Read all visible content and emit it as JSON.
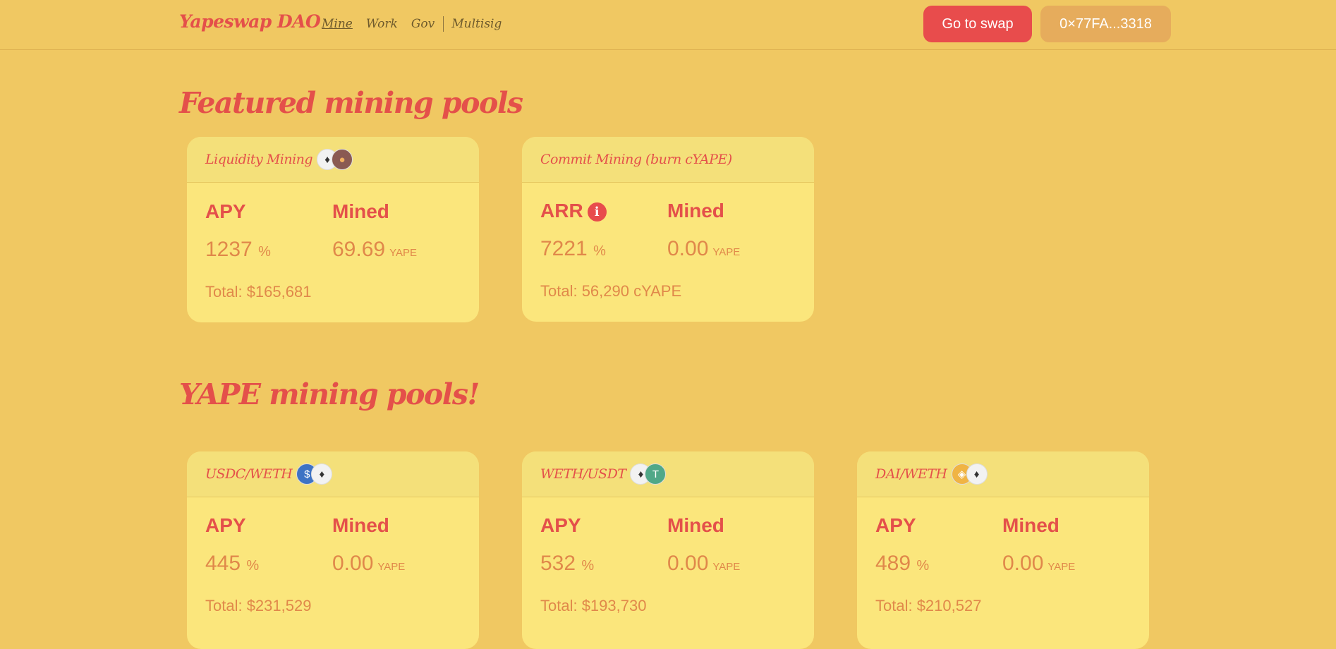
{
  "header": {
    "brand": "Yapeswap DAO",
    "nav": [
      "Mine",
      "Work",
      "Gov",
      "Multisig"
    ],
    "swap_button": "Go to swap",
    "wallet_button": "0×77FA...3318"
  },
  "featured": {
    "title": "Featured mining pools",
    "pools": [
      {
        "name": "Liquidity Mining",
        "coins": [
          "eth-icon",
          "ape-icon"
        ],
        "rate_label": "APY",
        "rate": "1237",
        "rate_unit": "%",
        "mined_label": "Mined",
        "mined": "69.69",
        "mined_unit": "YAPE",
        "total": "Total: $165,681"
      },
      {
        "name": "Commit Mining (burn cYAPE)",
        "coins": [],
        "rate_label": "ARR",
        "info_icon": "info-icon",
        "rate": "7221",
        "rate_unit": "%",
        "mined_label": "Mined",
        "mined": "0.00",
        "mined_unit": "YAPE",
        "total": "Total: 56,290 cYAPE"
      }
    ]
  },
  "yape": {
    "title": "YAPE mining pools!",
    "pools": [
      {
        "name": "USDC/WETH",
        "coins": [
          "usdc-icon",
          "eth-icon"
        ],
        "rate_label": "APY",
        "rate": "445",
        "rate_unit": "%",
        "mined_label": "Mined",
        "mined": "0.00",
        "mined_unit": "YAPE",
        "total": "Total: $231,529"
      },
      {
        "name": "WETH/USDT",
        "coins": [
          "eth-icon",
          "usdt-icon"
        ],
        "rate_label": "APY",
        "rate": "532",
        "rate_unit": "%",
        "mined_label": "Mined",
        "mined": "0.00",
        "mined_unit": "YAPE",
        "total": "Total: $193,730"
      },
      {
        "name": "DAI/WETH",
        "coins": [
          "dai-icon",
          "eth-icon"
        ],
        "rate_label": "APY",
        "rate": "489",
        "rate_unit": "%",
        "mined_label": "Mined",
        "mined": "0.00",
        "mined_unit": "YAPE",
        "total": "Total: $210,527"
      }
    ]
  },
  "colors": {
    "background": "#f0c862",
    "accent": "#e4504a",
    "card": "#fbe67c",
    "value": "#e0884a"
  }
}
